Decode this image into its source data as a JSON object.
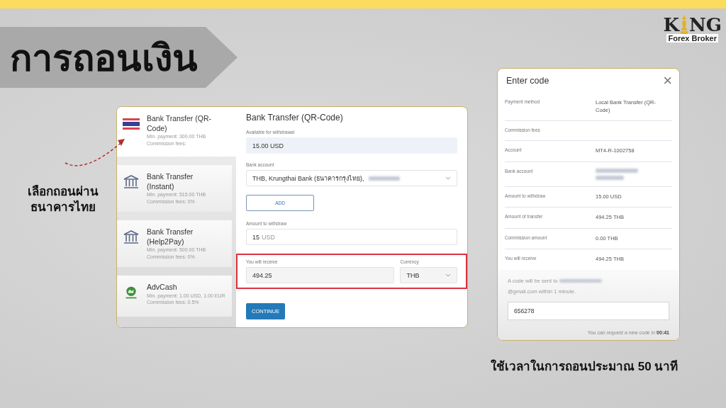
{
  "title": "การถอนเงิน",
  "logo": {
    "left": "K",
    "right": "NG",
    "tagline": "Forex Broker"
  },
  "side_note": "เลือกถอนผ่าน ธนาคารไทย",
  "methods": [
    {
      "kind": "flag",
      "name": "Bank Transfer (QR-Code)",
      "min": "Min. payment: 300.00 THB",
      "fees": "Commission fees:",
      "selected": true
    },
    {
      "kind": "bank",
      "name": "Bank Transfer (Instant)",
      "min": "Min. payment: 515.00 THB",
      "fees": "Commission fees: 0%",
      "selected": false
    },
    {
      "kind": "bank",
      "name": "Bank Transfer (Help2Pay)",
      "min": "Min. payment: 500.00 THB",
      "fees": "Commission fees: 0%",
      "selected": false
    },
    {
      "kind": "advcash",
      "name": "AdvCash",
      "min": "Min. payment: 1.00 USD, 1.00 EUR",
      "fees": "Commission fees: 0.5%",
      "selected": false
    }
  ],
  "form": {
    "title": "Bank Transfer (QR-Code)",
    "available_label": "Available for withdrawal",
    "available": "15.00 USD",
    "bank_label": "Bank account",
    "bank_value": "THB, Krungthai Bank (ธนาคารกรุงไทย),",
    "add_button": "ADD",
    "amount_label": "Amount to withdraw",
    "amount": "15",
    "amount_unit": "USD",
    "receive_label": "You will receive",
    "receive": "494.25",
    "currency_label": "Currency",
    "currency": "THB",
    "continue_button": "CONTINUE"
  },
  "dialog": {
    "title": "Enter code",
    "close": "×",
    "rows": [
      {
        "label": "Payment method",
        "value": "Local Bank Transfer (QR-Code)"
      },
      {
        "label": "Commission fees"
      },
      {
        "label": "Account",
        "value": "MT4-R-1002758"
      },
      {
        "label": "Bank account",
        "blurred": true
      },
      {
        "label": "Amount to withdraw",
        "value": "15.00 USD"
      },
      {
        "label": "Amount of transfer",
        "value": "494.25 THB"
      },
      {
        "label": "Commission amount",
        "value": "0.00 THB"
      },
      {
        "label": "You will receive",
        "value": "494.25 THB"
      }
    ],
    "note_start": "A code will be sent to",
    "note_end": "@gmail.com within 1 minute.",
    "code": "656278",
    "timer": "You can request a new code in **00:41**"
  },
  "caption": "ใช้เวลาในการถอนประมาณ 50 นาที"
}
